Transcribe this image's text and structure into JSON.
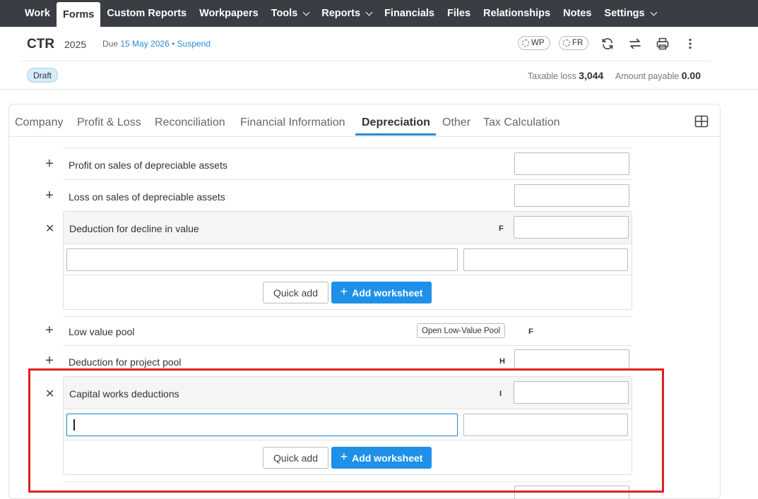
{
  "nav": {
    "items": [
      {
        "label": "Work",
        "dropdown": false,
        "active": false
      },
      {
        "label": "Forms",
        "dropdown": false,
        "active": true
      },
      {
        "label": "Custom Reports",
        "dropdown": false,
        "active": false
      },
      {
        "label": "Workpapers",
        "dropdown": false,
        "active": false
      },
      {
        "label": "Tools",
        "dropdown": true,
        "active": false
      },
      {
        "label": "Reports",
        "dropdown": true,
        "active": false
      },
      {
        "label": "Financials",
        "dropdown": false,
        "active": false
      },
      {
        "label": "Files",
        "dropdown": false,
        "active": false
      },
      {
        "label": "Relationships",
        "dropdown": false,
        "active": false
      },
      {
        "label": "Notes",
        "dropdown": false,
        "active": false
      },
      {
        "label": "Settings",
        "dropdown": true,
        "active": false
      }
    ]
  },
  "header": {
    "form_title": "CTR",
    "year": "2025",
    "due_prefix": "Due",
    "due_date": "15 May 2026",
    "separator": "•",
    "suspend_label": "Suspend",
    "wp_label": "WP",
    "fr_label": "FR",
    "status_badge": "Draft",
    "taxable_loss_label": "Taxable loss",
    "taxable_loss_value": "3,044",
    "amount_payable_label": "Amount payable",
    "amount_payable_value": "0.00",
    "icons": [
      "refresh-icon",
      "swap-icon",
      "print-icon",
      "more-vertical-icon"
    ]
  },
  "tabs": [
    {
      "label": "Company",
      "active": false
    },
    {
      "label": "Profit & Loss",
      "active": false
    },
    {
      "label": "Reconciliation",
      "active": false
    },
    {
      "label": "Financial Information",
      "active": false
    },
    {
      "label": "Depreciation",
      "active": true
    },
    {
      "label": "Other",
      "active": false
    },
    {
      "label": "Tax Calculation",
      "active": false
    }
  ],
  "rows": {
    "profit_on_sales": {
      "label": "Profit on sales of depreciable assets",
      "value": ""
    },
    "loss_on_sales": {
      "label": "Loss on sales of depreciable assets",
      "value": ""
    },
    "decline_in_value": {
      "label": "Deduction for decline in value",
      "code": "F",
      "value": "",
      "description_value": "",
      "amount_value": ""
    },
    "low_value_pool": {
      "label": "Low value pool",
      "button_label": "Open Low-Value Pool",
      "code": "F"
    },
    "project_pool": {
      "label": "Deduction for project pool",
      "code": "H",
      "value": ""
    },
    "capital_works": {
      "label": "Capital works deductions",
      "code": "I",
      "value": "",
      "description_value": "",
      "amount_value": ""
    }
  },
  "actions": {
    "quick_add_label": "Quick add",
    "add_worksheet_label": "Add worksheet"
  },
  "colors": {
    "nav_bg": "#3a3d44",
    "accent": "#1e90e8",
    "highlight": "#e02020",
    "badge_bg": "#d7ecfb"
  }
}
